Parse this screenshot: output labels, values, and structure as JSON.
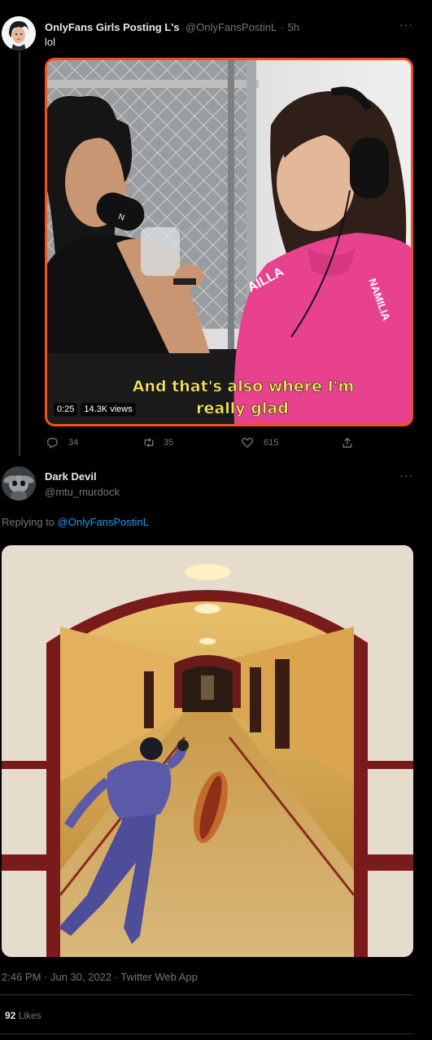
{
  "tweet1": {
    "display_name": "OnlyFans Girls Posting L's",
    "handle": "@OnlyFansPostinL",
    "sep": "·",
    "time": "5h",
    "text": "lol",
    "video": {
      "caption_line1": "And that's also where I'm",
      "caption_line2": "really glad",
      "duration": "0:25",
      "views": "14.3K views",
      "mic_brand": "N",
      "shirt_text_1": "AILLA",
      "shirt_text_2": "NAMILIA"
    },
    "actions": {
      "replies": "34",
      "retweets": "35",
      "likes": "615"
    }
  },
  "tweet2": {
    "display_name": "Dark Devil",
    "handle": "@mtu_murdock",
    "replying_prefix": "Replying to",
    "replying_to": "@OnlyFansPostinL",
    "timestamp": "2:46 PM · Jun 30, 2022 · Twitter Web App",
    "likes_count": "92",
    "likes_label": "Likes"
  },
  "colors": {
    "background": "#000000",
    "text_primary": "#e7e9ea",
    "text_secondary": "#71767b",
    "link": "#1d9bf0",
    "video_border": "#f4511e",
    "caption_yellow": "#f7e45c"
  },
  "icons": [
    "reply-icon",
    "retweet-icon",
    "like-icon",
    "share-icon",
    "more-icon"
  ]
}
